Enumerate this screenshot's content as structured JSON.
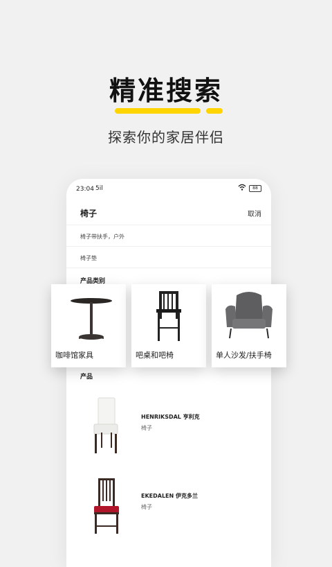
{
  "promo": {
    "title": "精准搜索",
    "subtitle": "探索你的家居伴侣"
  },
  "status_bar": {
    "time": "23:04",
    "signal": "5il",
    "battery": "88"
  },
  "search": {
    "query": "椅子",
    "cancel_label": "取消"
  },
  "suggestions": [
    "椅子带扶手，户外",
    "椅子垫"
  ],
  "categories": {
    "section_label": "产品类别",
    "items": [
      {
        "label": "咖啡馆家具",
        "icon": "cafe-table"
      },
      {
        "label": "吧桌和吧椅",
        "icon": "bar-stool"
      },
      {
        "label": "单人沙发/扶手椅",
        "icon": "armchair"
      }
    ]
  },
  "products": {
    "section_label": "产品",
    "items": [
      {
        "name": "HENRIKSDAL 亨利克",
        "category": "椅子",
        "colors": {
          "seat": "#f4f4f2",
          "frame": "#3a2a22"
        }
      },
      {
        "name": "EKEDALEN 伊克多兰",
        "category": "椅子",
        "colors": {
          "seat": "#b0152a",
          "frame": "#3b2a23"
        }
      }
    ]
  },
  "colors": {
    "accent": "#FFD400",
    "background": "#f1f1f1"
  }
}
